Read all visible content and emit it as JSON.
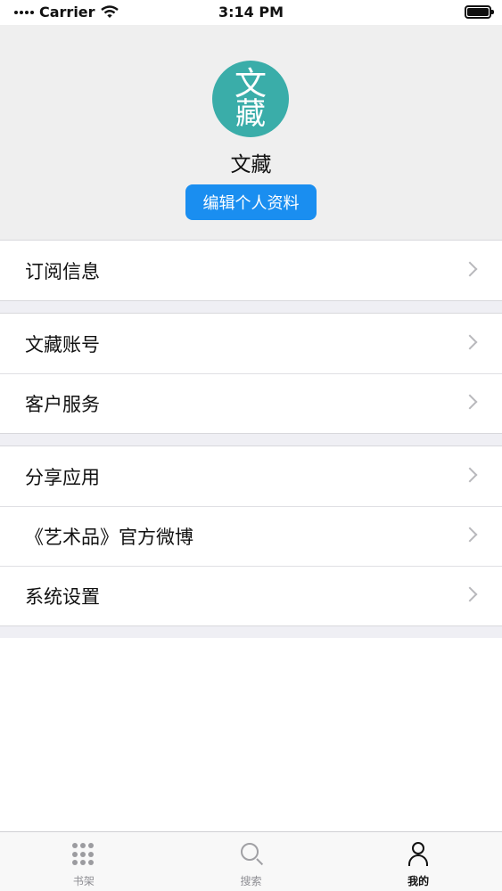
{
  "status_bar": {
    "carrier": "Carrier",
    "time": "3:14 PM"
  },
  "profile": {
    "avatar_text_top": "文",
    "avatar_text_bottom": "藏",
    "name": "文藏",
    "edit_button": "编辑个人资料",
    "avatar_color": "#3aada9",
    "button_color": "#1a8ef0"
  },
  "menu": {
    "groups": [
      {
        "items": [
          {
            "label": "订阅信息"
          }
        ]
      },
      {
        "items": [
          {
            "label": "文藏账号"
          },
          {
            "label": "客户服务"
          }
        ]
      },
      {
        "items": [
          {
            "label": "分享应用"
          },
          {
            "label": "《艺术品》官方微博"
          },
          {
            "label": "系统设置"
          }
        ]
      }
    ]
  },
  "tab_bar": {
    "tabs": [
      {
        "label": "书架",
        "icon": "grid-icon",
        "active": false
      },
      {
        "label": "搜索",
        "icon": "search-icon",
        "active": false
      },
      {
        "label": "我的",
        "icon": "user-icon",
        "active": true
      }
    ]
  }
}
